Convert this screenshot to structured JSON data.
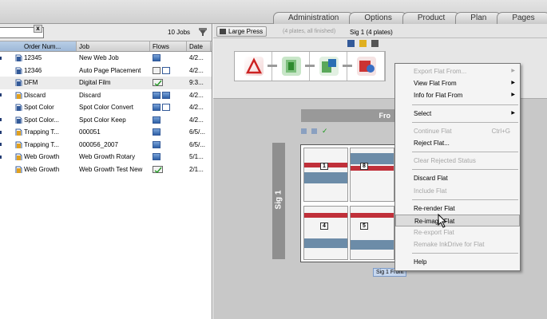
{
  "tabs": [
    "Administration",
    "Options",
    "Product",
    "Plan",
    "Pages"
  ],
  "joblist": {
    "search_value": "",
    "clear_label": "x",
    "job_count": "10 Jobs",
    "columns": [
      "Order Num...",
      "Job",
      "Flows",
      "Date"
    ],
    "rows": [
      {
        "order": "12345",
        "job": "New Web Job",
        "date": "4/2..."
      },
      {
        "order": "12346",
        "job": "Auto Page Placement",
        "date": "4/2..."
      },
      {
        "order": "DFM",
        "job": "Digital Film",
        "date": "9:3..."
      },
      {
        "order": "Discard",
        "job": "Discard",
        "date": "4/2..."
      },
      {
        "order": "Spot Color",
        "job": "Spot Color Convert",
        "date": "4/2..."
      },
      {
        "order": "Spot Color...",
        "job": "Spot Color Keep",
        "date": "4/2..."
      },
      {
        "order": "Trapping T...",
        "job": "000051",
        "date": "6/5/..."
      },
      {
        "order": "Trapping T...",
        "job": "000056_2007",
        "date": "6/5/..."
      },
      {
        "order": "Web Growth",
        "job": "Web Growth Rotary",
        "date": "5/1..."
      },
      {
        "order": "Web Growth",
        "job": "Web Growth Test New",
        "date": "2/1..."
      }
    ]
  },
  "press": {
    "button_label": "Large Press",
    "plates_status": "(4 plates, all finished)",
    "sig_status": "Sig 1 (4 plates)"
  },
  "layout": {
    "front_label": "Fro",
    "sig_label": "Sig 1",
    "page_numbers": [
      "1",
      "8",
      "4",
      "5"
    ],
    "sig_front_label": "Sig 1 Front"
  },
  "menu": {
    "items": [
      {
        "label": "Export Flat From...",
        "disabled": true,
        "submenu": true
      },
      {
        "label": "View Flat From",
        "disabled": false,
        "submenu": true
      },
      {
        "label": "Info for Flat From",
        "disabled": false,
        "submenu": true
      },
      {
        "sep": true
      },
      {
        "label": "Select",
        "disabled": false,
        "submenu": true
      },
      {
        "sep": true
      },
      {
        "label": "Continue Flat",
        "disabled": true,
        "shortcut": "Ctrl+G"
      },
      {
        "label": "Reject Flat...",
        "disabled": false
      },
      {
        "sep": true
      },
      {
        "label": "Clear Rejected Status",
        "disabled": true
      },
      {
        "sep": true
      },
      {
        "label": "Discard Flat",
        "disabled": false
      },
      {
        "label": "Include Flat",
        "disabled": true
      },
      {
        "sep": true
      },
      {
        "label": "Re-render Flat",
        "disabled": false
      },
      {
        "label": "Re-image Flat",
        "disabled": false,
        "highlighted": true
      },
      {
        "label": "Re-export Flat",
        "disabled": true
      },
      {
        "label": "Remake InkDrive for Flat",
        "disabled": true
      },
      {
        "sep": true
      },
      {
        "label": "Help",
        "disabled": false
      }
    ]
  },
  "icons": {
    "clear": "close-icon",
    "filter": "filter-icon",
    "press": "press-icon",
    "job": "job-icon",
    "flow": "flow-icon"
  }
}
